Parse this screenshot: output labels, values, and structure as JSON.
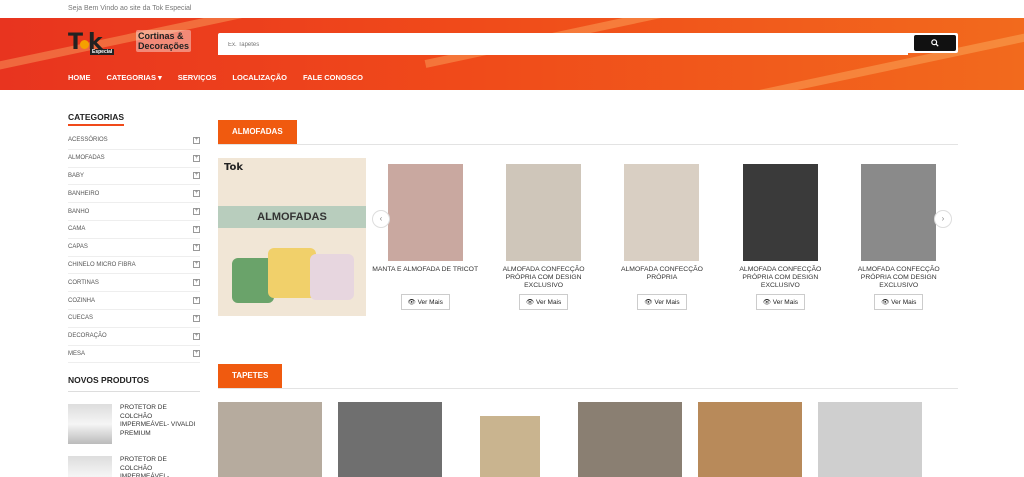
{
  "topbar": {
    "welcome": "Seja Bem Vindo ao site da Tok Especial"
  },
  "logo": {
    "tk": "Tok",
    "especial": "Especial",
    "brand1": "Cortinas &",
    "brand2": "Decorações"
  },
  "search": {
    "placeholder": "Ex. Tapetes",
    "button_icon": "search-icon"
  },
  "nav": {
    "items": [
      "HOME",
      "CATEGORIAS ▾",
      "SERVIÇOS",
      "LOCALIZAÇÃO",
      "FALE CONOSCO"
    ]
  },
  "sidebar": {
    "title": "CATEGORIAS",
    "categories": [
      "ACESSÓRIOS",
      "ALMOFADAS",
      "BABY",
      "BANHEIRO",
      "BANHO",
      "CAMA",
      "CAPAS",
      "CHINELO MICRO FIBRA",
      "CORTINAS",
      "COZINHA",
      "CUECAS",
      "DECORAÇÃO",
      "MESA"
    ],
    "new_title": "NOVOS PRODUTOS",
    "new_products": [
      "PROTETOR DE COLCHÃO IMPERMEÁVEL- VIVALDI PREMIUM",
      "PROTETOR DE COLCHÃO IMPERMEÁVEL- BUETTNER"
    ]
  },
  "almofadas": {
    "heading": "ALMOFADAS",
    "banner_title": "ALMOFADAS",
    "banner_logo": "Tok",
    "products": [
      "MANTA E ALMOFADA DE TRICOT",
      "ALMOFADA CONFECÇÃO PRÓPRIA COM DESIGN EXCLUSIVO",
      "ALMOFADA CONFECÇÃO PRÓPRIA",
      "ALMOFADA CONFECÇÃO PRÓPRIA COM DESIGN EXCLUSIVO",
      "ALMOFADA CONFECÇÃO PRÓPRIA COM DESIGN EXCLUSIVO"
    ],
    "button_label": "👁 Ver Mais",
    "colors": [
      "#c9a8a0",
      "#cfc6ba",
      "#d9cfc3",
      "#3a3a3a",
      "#8a8a8a"
    ]
  },
  "tapetes": {
    "heading": "TAPETES",
    "colors": [
      "#b6ab9e",
      "#6f6f6f",
      "#c9b48f",
      "#8a7f72",
      "#b88a5a",
      "#cfcfcf"
    ]
  }
}
